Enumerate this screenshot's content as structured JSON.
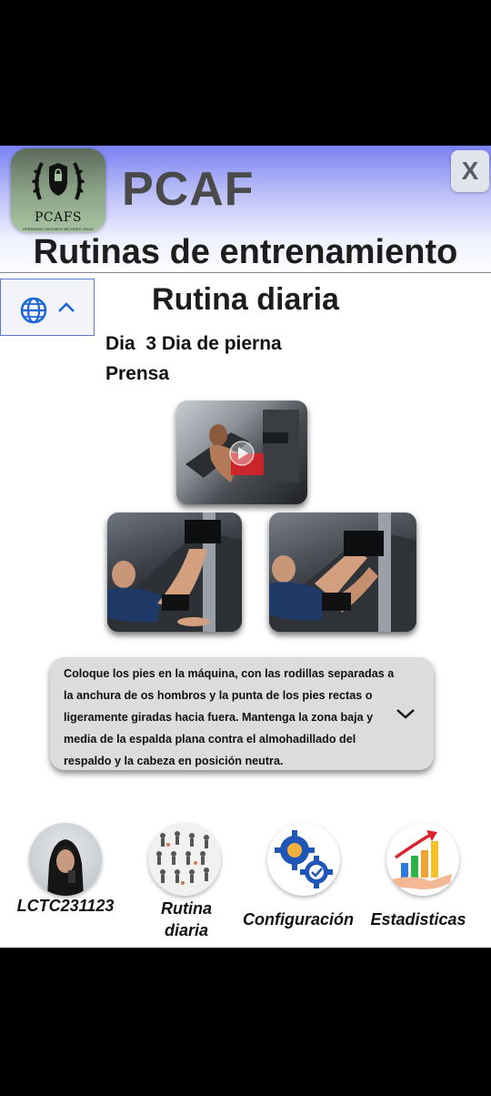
{
  "app": {
    "logo_text": "PCAFS",
    "logo_subtext": "PERSONAS HACEMOS MEJORES VIDAS",
    "title": "PCAF",
    "close_label": "X"
  },
  "header": {
    "page_title": "Rutinas de entrenamiento"
  },
  "language": {
    "icon": "globe-icon",
    "toggle_icon": "chevron-up-icon"
  },
  "routine": {
    "section_title": "Rutina diaria",
    "day_label": "Dia  3 Dia de pierna",
    "exercise_name": "Prensa",
    "images": [
      "exercise-video-thumbnail",
      "exercise-step-1-photo",
      "exercise-step-2-photo"
    ],
    "description": "Coloque los pies en la máquina, con las rodillas separadas a la anchura de os hombros y la punta de los pies rectas o ligeramente giradas hacia fuera. Mantenga la zona baja y media de la espalda plana contra el almohadillado del respaldo y la cabeza en posición neutra."
  },
  "bottom_nav": [
    {
      "label": "LCTC231123",
      "icon": "user-avatar"
    },
    {
      "label": "Rutina diaria",
      "icon": "exercise-chart-icon"
    },
    {
      "label": "Configuración",
      "icon": "gears-icon"
    },
    {
      "label": "Estadisticas",
      "icon": "growth-chart-icon"
    }
  ],
  "colors": {
    "header_gradient_top": "#7a82f2",
    "card_background": "#dcdcdc",
    "language_border": "#5b7ad6",
    "icon_blue": "#1a66d6"
  }
}
